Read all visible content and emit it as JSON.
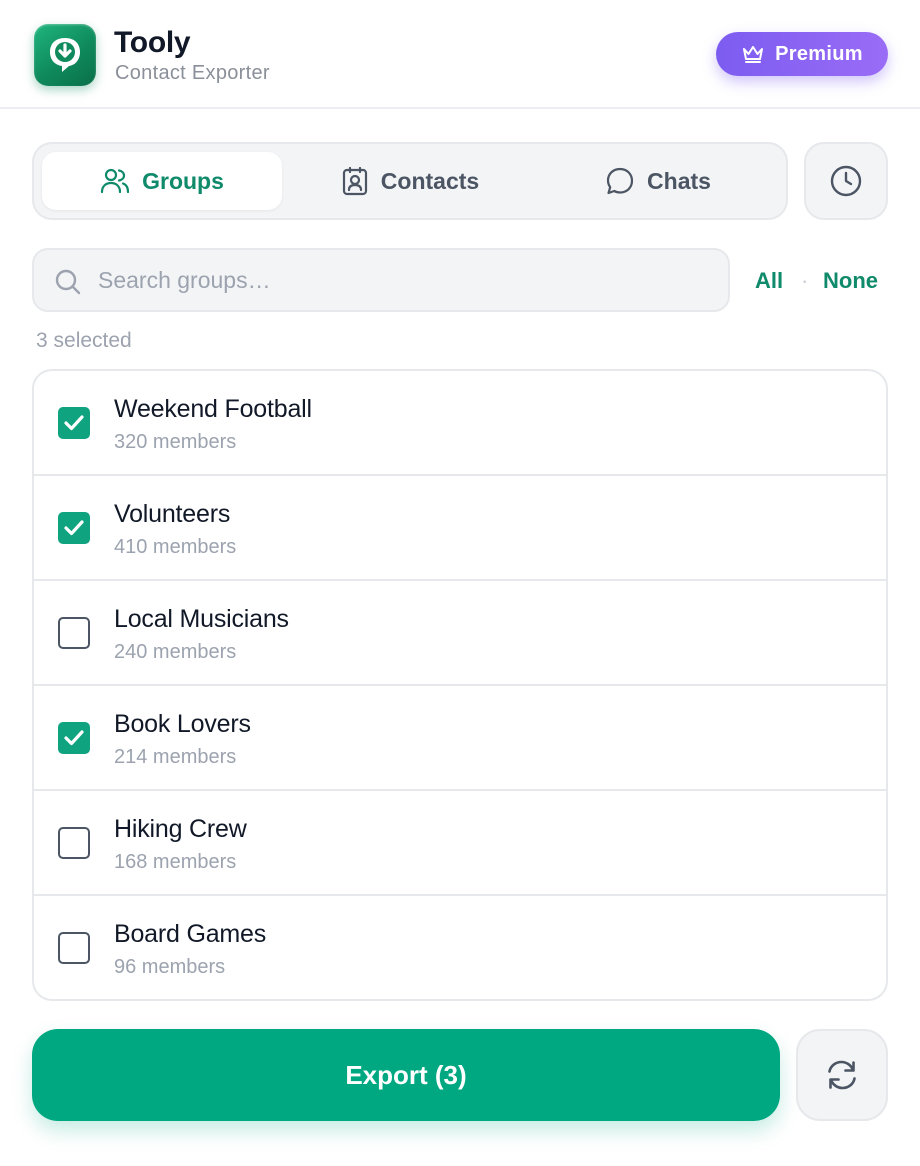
{
  "app": {
    "title": "Tooly",
    "subtitle": "Contact Exporter",
    "premium_label": "Premium",
    "logo_icon": "download-chat-icon",
    "brand_color": "#0f8a6a",
    "premium_color": "#7c5cf0"
  },
  "tabs": [
    {
      "label": "Groups",
      "icon": "users-icon",
      "active": true
    },
    {
      "label": "Contacts",
      "icon": "contact-card-icon",
      "active": false
    },
    {
      "label": "Chats",
      "icon": "chat-bubble-icon",
      "active": false
    }
  ],
  "history_icon": "clock-icon",
  "search": {
    "placeholder": "Search groups…",
    "value": ""
  },
  "selection": {
    "all_label": "All",
    "separator": "·",
    "none_label": "None",
    "count_text": "3 selected"
  },
  "groups": [
    {
      "name": "Weekend Football",
      "members": "320 members",
      "checked": true
    },
    {
      "name": "Volunteers",
      "members": "410 members",
      "checked": true
    },
    {
      "name": "Local Musicians",
      "members": "240 members",
      "checked": false
    },
    {
      "name": "Book Lovers",
      "members": "214 members",
      "checked": true
    },
    {
      "name": "Hiking Crew",
      "members": "168 members",
      "checked": false
    },
    {
      "name": "Board Games",
      "members": "96 members",
      "checked": false
    }
  ],
  "footer": {
    "export_label": "Export (3)",
    "export_color": "#00a882",
    "refresh_icon": "refresh-icon"
  }
}
